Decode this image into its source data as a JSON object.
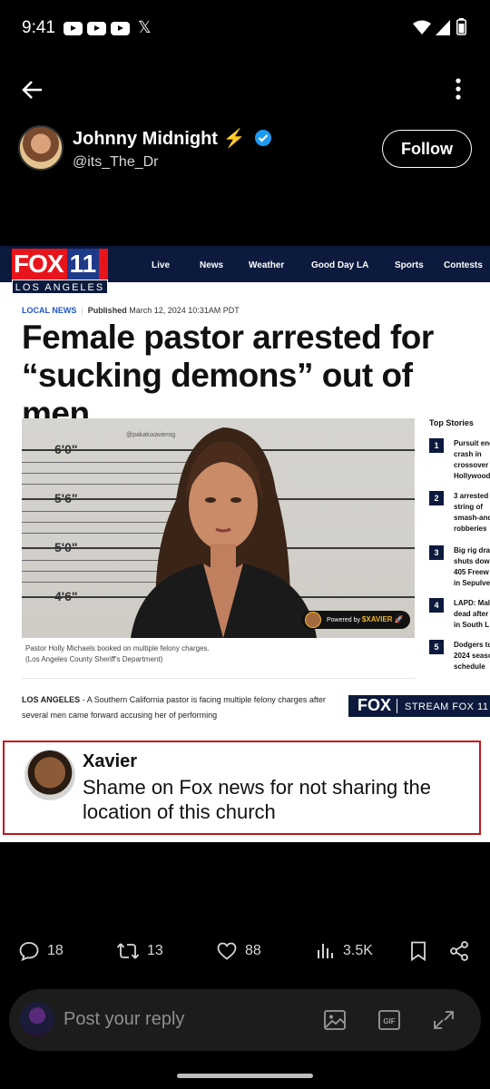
{
  "status_bar": {
    "time": "9:41"
  },
  "header": {
    "back_icon": "arrow-left-icon",
    "more_icon": "more-vertical-icon"
  },
  "author": {
    "name": "Johnny Midnight ⚡",
    "handle": "@its_The_Dr",
    "verified_color": "#1d9bf0"
  },
  "follow_label": "Follow",
  "article": {
    "logo_text": "FOX",
    "logo_number": "11",
    "logo_city": "LOS ANGELES",
    "nav": [
      "Live",
      "News",
      "Weather",
      "Good Day LA",
      "Sports",
      "Contests"
    ],
    "category": "LOCAL NEWS",
    "published_label": "Published",
    "published_date": "March 12, 2024 10:31AM PDT",
    "headline": "Female pastor arrested for “sucking demons” out of men",
    "height_marks": [
      "6'0\"",
      "5'6\"",
      "5'0\"",
      "4'6\""
    ],
    "watermark": "@pakaluxavierog",
    "badge_prefix": "Powered by",
    "badge_token": "$XAVIER 🚀",
    "caption_line1": "Pastor Holly Michaels booked on multiple felony charges.",
    "caption_line2": "(Los Angeles County Sheriff's Department)",
    "top_stories_title": "Top Stories",
    "top_stories": [
      {
        "num": "1",
        "text": "Pursuit end\ncrash in\ncrossover\nHollywood"
      },
      {
        "num": "2",
        "text": "3 arrested\nstring of\nsmash-and\nrobberies"
      },
      {
        "num": "3",
        "text": "Big rig dra\nshuts dow\n405 Freew\nin Sepulve"
      },
      {
        "num": "4",
        "text": "LAPD: Mal\ndead after\nin South L"
      },
      {
        "num": "5",
        "text": "Dodgers to\n2024 seaso\nschedule"
      }
    ],
    "lead_dateline": "LOS ANGELES",
    "lead_text": " - A Southern California pastor is facing multiple felony charges after several men came forward accusing her of performing",
    "stream_fox": "FOX",
    "stream_label": "STREAM FOX 11"
  },
  "overlay_reply": {
    "name": "Xavier",
    "text": "Shame on Fox news for not sharing the location of this church",
    "border_color": "#c2161e"
  },
  "actions": {
    "replies": "18",
    "reposts": "13",
    "likes": "88",
    "views": "3.5K"
  },
  "composer": {
    "placeholder": "Post your reply"
  }
}
